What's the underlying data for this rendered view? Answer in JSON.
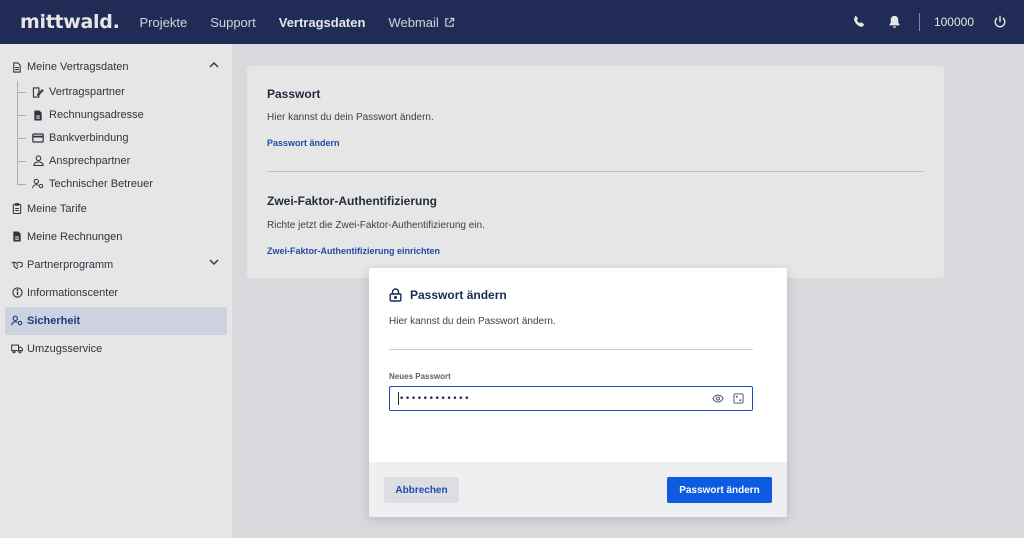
{
  "header": {
    "logo": "mittwald.",
    "nav": [
      "Projekte",
      "Support",
      "Vertragsdaten",
      "Webmail"
    ],
    "active_nav": "Vertragsdaten",
    "customer_number": "100000",
    "icons": [
      "phone-icon",
      "bell-icon",
      "power-icon"
    ]
  },
  "sidebar": {
    "items": [
      {
        "label": "Meine Vertragsdaten",
        "icon": "document-icon",
        "expanded": true
      },
      {
        "label": "Vertragspartner",
        "icon": "contract-edit-icon"
      },
      {
        "label": "Rechnungsadresse",
        "icon": "invoice-icon"
      },
      {
        "label": "Bankverbindung",
        "icon": "credit-card-icon"
      },
      {
        "label": "Ansprechpartner",
        "icon": "user-icon"
      },
      {
        "label": "Technischer Betreuer",
        "icon": "user-gear-icon"
      },
      {
        "label": "Meine Tarife",
        "icon": "clipboard-icon"
      },
      {
        "label": "Meine Rechnungen",
        "icon": "invoice-icon"
      },
      {
        "label": "Partnerprogramm",
        "icon": "handshake-icon",
        "expanded": false
      },
      {
        "label": "Informationscenter",
        "icon": "info-icon"
      },
      {
        "label": "Sicherheit",
        "icon": "user-gear-icon",
        "active": true
      },
      {
        "label": "Umzugsservice",
        "icon": "truck-icon"
      }
    ]
  },
  "main": {
    "password": {
      "title": "Passwort",
      "description": "Hier kannst du dein Passwort ändern.",
      "link": "Passwort ändern"
    },
    "twofa": {
      "title": "Zwei-Faktor-Authentifizierung",
      "description": "Richte jetzt die Zwei-Faktor-Authentifizierung ein.",
      "link": "Zwei-Faktor-Authentifizierung einrichten"
    }
  },
  "modal": {
    "title": "Passwort ändern",
    "description": "Hier kannst du dein Passwort ändern.",
    "field_label": "Neues Passwort",
    "field_value": "••••••••••••",
    "cancel_label": "Abbrechen",
    "submit_label": "Passwort ändern"
  },
  "colors": {
    "header_bg": "#1d2a59",
    "primary": "#0d5be1",
    "link": "#1f4bb8",
    "active_bg": "#e3e8f7"
  }
}
